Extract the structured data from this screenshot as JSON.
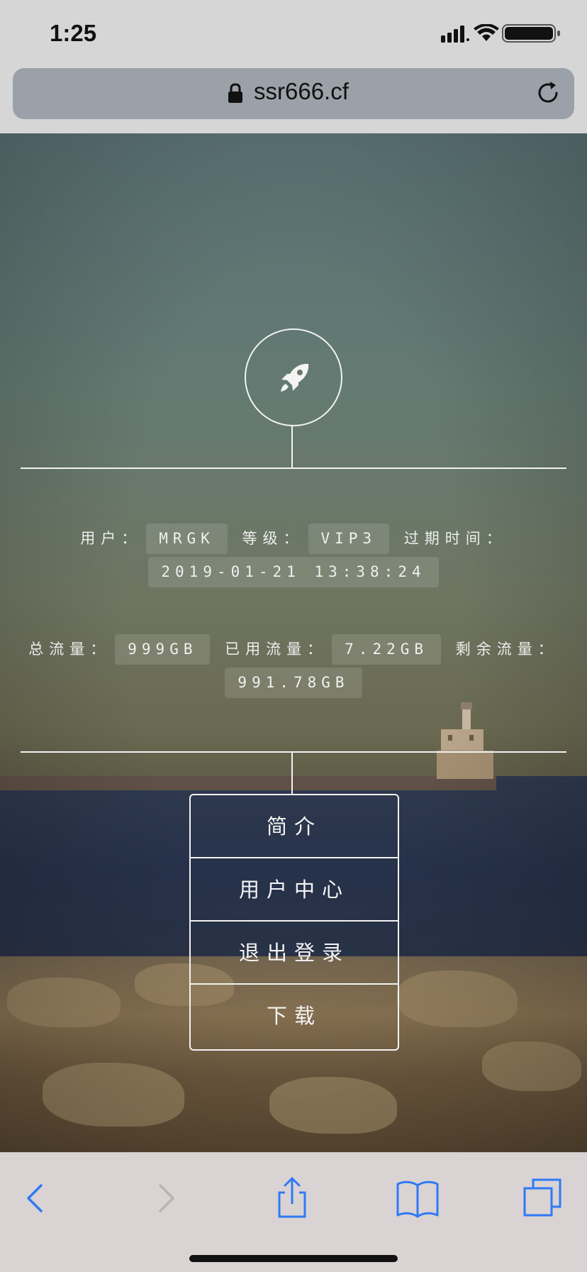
{
  "status_bar": {
    "time": "1:25",
    "icons": [
      "signal-icon",
      "wifi-icon",
      "battery-icon"
    ]
  },
  "browser": {
    "url": "ssr666.cf",
    "icons": [
      "lock-icon",
      "reload-icon"
    ]
  },
  "hero": {
    "icon": "rocket-icon"
  },
  "account": {
    "user_label": "用户：",
    "user_value": "MRGK",
    "level_label": "等级：",
    "level_value": "VIP3",
    "expire_label": "过期时间：",
    "expire_value": "2019-01-21 13:38:24",
    "total_label": "总流量：",
    "total_value": "999GB",
    "used_label": "已用流量：",
    "used_value": "7.22GB",
    "remain_label": "剩余流量：",
    "remain_value": "991.78GB"
  },
  "menu": {
    "items": [
      {
        "label": "简介"
      },
      {
        "label": "用户中心"
      },
      {
        "label": "退出登录"
      },
      {
        "label": "下载"
      }
    ]
  },
  "toolbar": {
    "items": [
      "back-icon",
      "forward-icon",
      "share-icon",
      "bookmarks-icon",
      "tabs-icon"
    ]
  },
  "colors": {
    "accent": "#2f7af5",
    "disabled": "#b9b4b4",
    "line": "#f2f2f2"
  }
}
